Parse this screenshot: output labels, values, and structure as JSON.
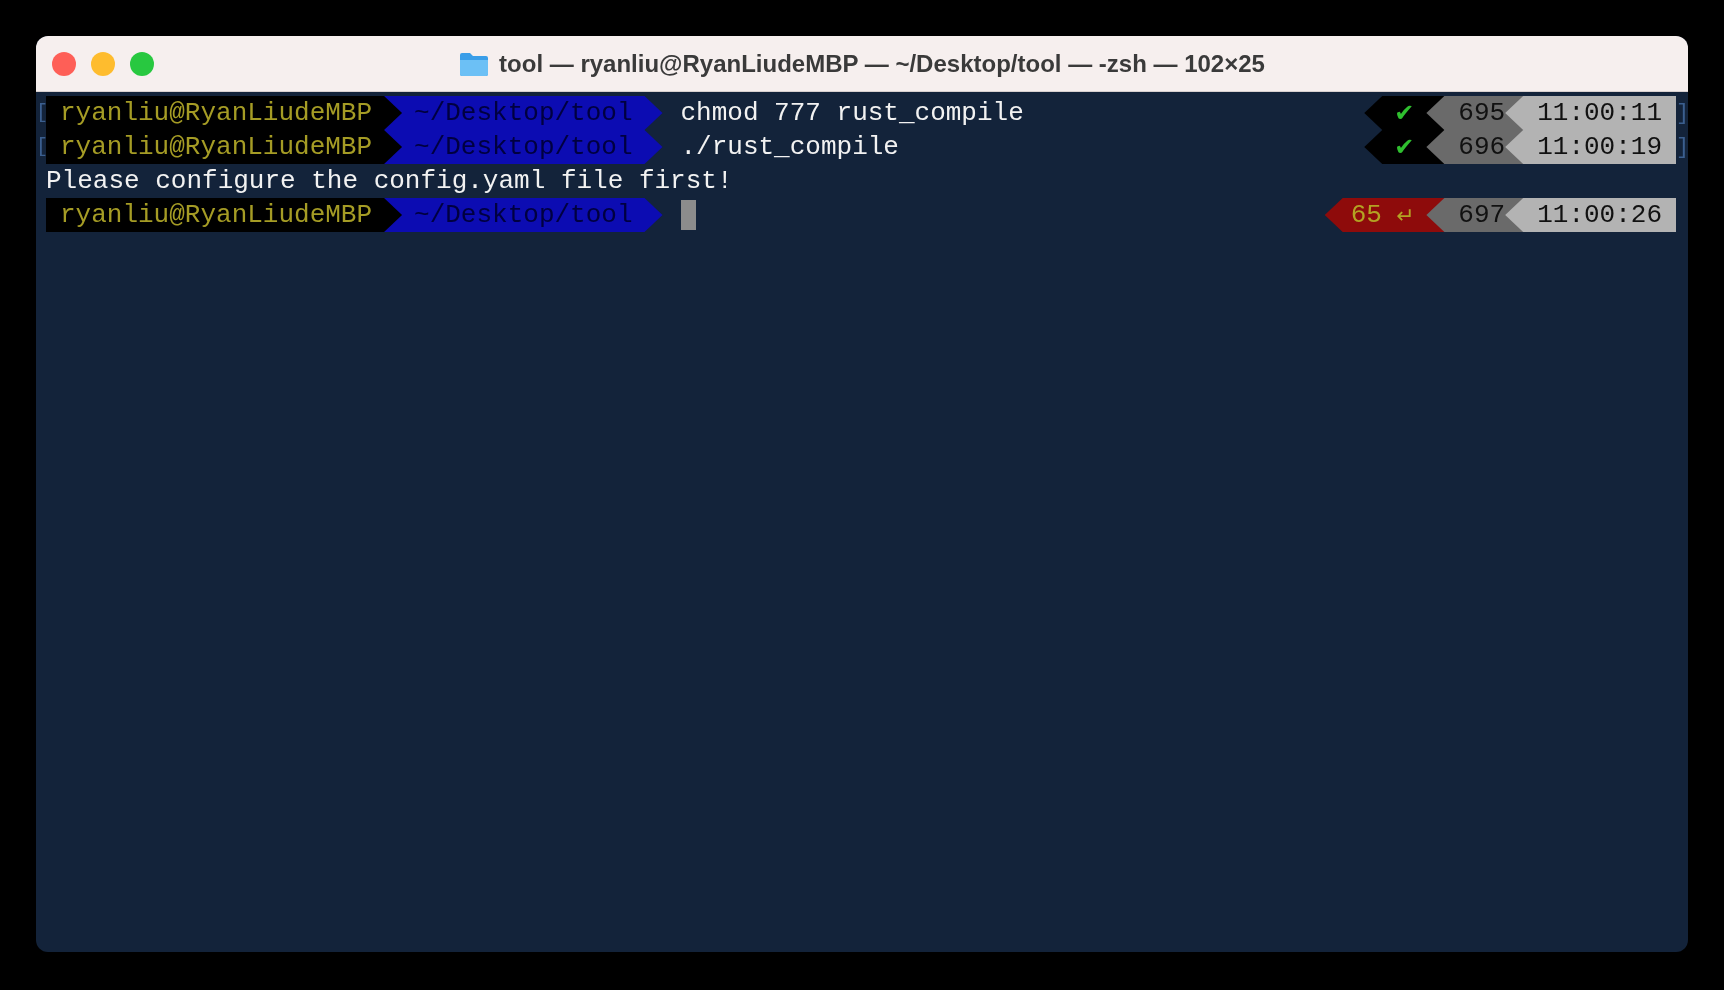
{
  "window": {
    "title": "tool — ryanliu@RyanLiudeMBP — ~/Desktop/tool — -zsh — 102×25"
  },
  "lines": [
    {
      "kind": "prompt",
      "bracket_left": "[",
      "user": "ryanliu@RyanLiudeMBP",
      "path": "~/Desktop/tool",
      "command": "chmod 777 rust_compile",
      "status": {
        "kind": "ok",
        "text": "✔"
      },
      "history": "695",
      "time": "11:00:11",
      "bracket_right": "]"
    },
    {
      "kind": "prompt",
      "bracket_left": "[",
      "user": "ryanliu@RyanLiudeMBP",
      "path": "~/Desktop/tool",
      "command": "./rust_compile",
      "status": {
        "kind": "ok",
        "text": "✔"
      },
      "history": "696",
      "time": "11:00:19",
      "bracket_right": "]"
    },
    {
      "kind": "output",
      "text": "Please configure the config.yaml file first!"
    },
    {
      "kind": "prompt",
      "user": "ryanliu@RyanLiudeMBP",
      "path": "~/Desktop/tool",
      "cursor": true,
      "status": {
        "kind": "error",
        "code": "65",
        "symbol": "↵"
      },
      "history": "697",
      "time": "11:00:26"
    }
  ]
}
